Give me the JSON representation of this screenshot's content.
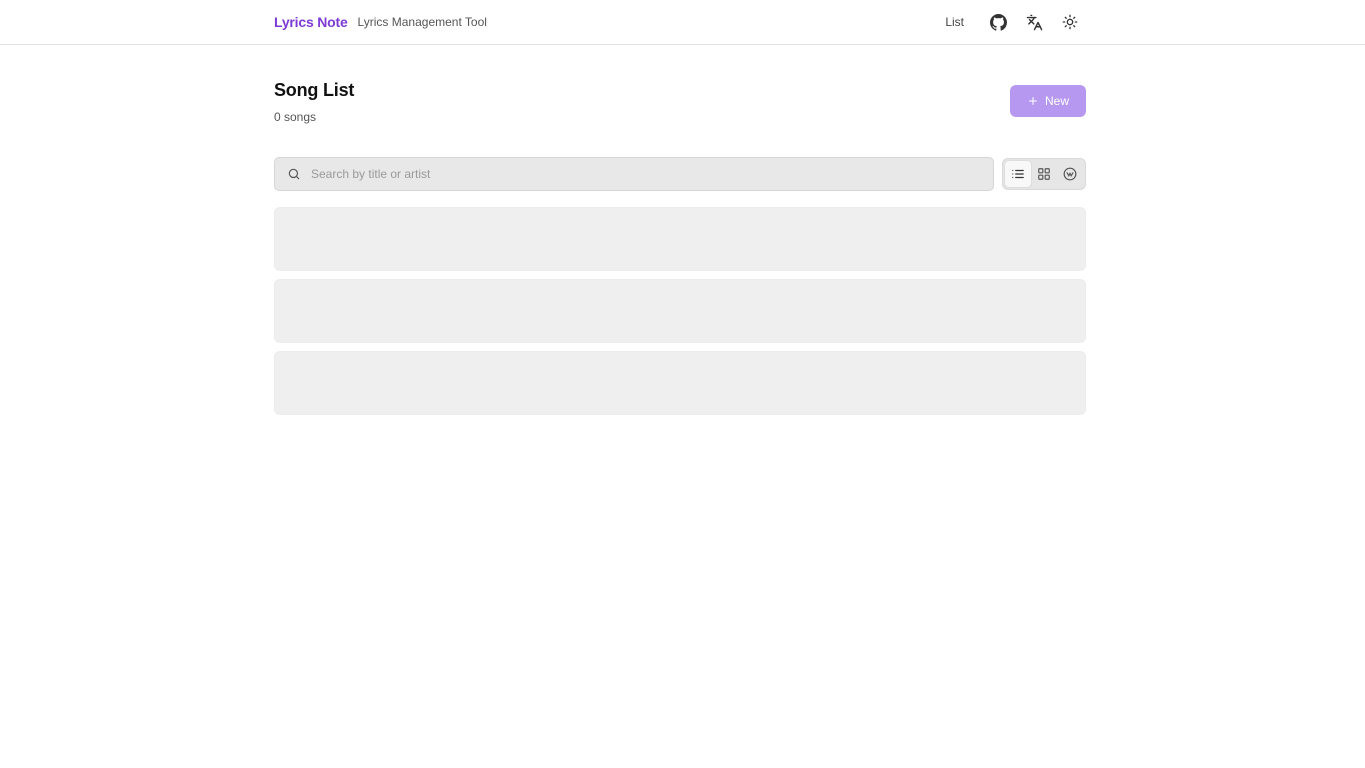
{
  "header": {
    "brand": "Lyrics Note",
    "tagline": "Lyrics Management Tool",
    "nav_list_label": "List",
    "icons": [
      "github-icon",
      "translate-icon",
      "sun-icon"
    ]
  },
  "main": {
    "title": "Song List",
    "song_count": "0 songs",
    "new_button_label": "New"
  },
  "search": {
    "placeholder": "Search by title or artist",
    "value": ""
  },
  "view_modes": [
    {
      "name": "list",
      "icon": "list-icon",
      "active": true
    },
    {
      "name": "grid",
      "icon": "grid-icon",
      "active": false
    },
    {
      "name": "artist",
      "icon": "circle-badge-icon",
      "active": false
    }
  ],
  "skeleton_rows": 3,
  "colors": {
    "brand": "#7e3bd6",
    "new_button": "#b798f0",
    "skeleton": "#efefef"
  }
}
